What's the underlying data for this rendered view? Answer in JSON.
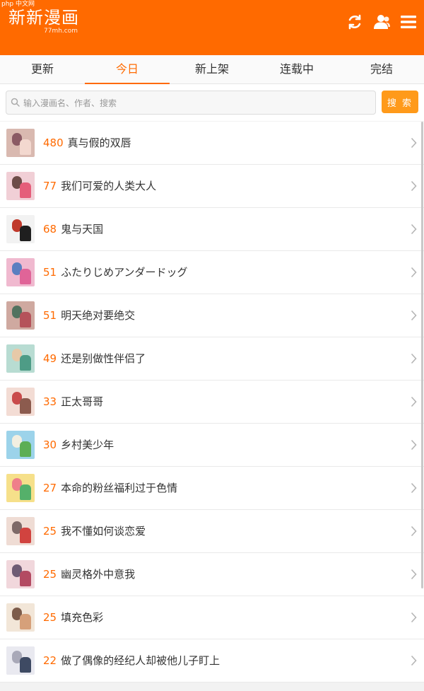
{
  "watermark": "php 中文网",
  "header": {
    "logo_text": "新新漫画",
    "logo_sub": "77mh.com",
    "icons": [
      "refresh-icon",
      "user-icon",
      "menu-icon"
    ],
    "bg_color": "#ff6a00"
  },
  "tabs": [
    {
      "label": "更新",
      "active": false
    },
    {
      "label": "今日",
      "active": true
    },
    {
      "label": "新上架",
      "active": false
    },
    {
      "label": "连载中",
      "active": false
    },
    {
      "label": "完结",
      "active": false
    }
  ],
  "search": {
    "placeholder": "输入漫画名、作者、搜索",
    "value": "",
    "button_label": "搜 索"
  },
  "list": [
    {
      "count": "480",
      "title": "真与假的双唇",
      "palette": [
        "#d9b9b0",
        "#f3d8cf",
        "#8a5a64"
      ]
    },
    {
      "count": "77",
      "title": "我们可爱的人类大人",
      "palette": [
        "#f1cfd6",
        "#e55e7a",
        "#6d4c48"
      ]
    },
    {
      "count": "68",
      "title": "鬼与天国",
      "palette": [
        "#f2f2f2",
        "#1f1f1f",
        "#c0392b"
      ]
    },
    {
      "count": "51",
      "title": "ふたりじめアンダードッグ",
      "palette": [
        "#f0b9cf",
        "#e06498",
        "#5a7fc0"
      ]
    },
    {
      "count": "51",
      "title": "明天绝对要绝交",
      "palette": [
        "#cfa9a0",
        "#b5525a",
        "#52725f"
      ]
    },
    {
      "count": "49",
      "title": "还是别做性伴侣了",
      "palette": [
        "#b8dcd2",
        "#4e9c86",
        "#e7c9a8"
      ]
    },
    {
      "count": "33",
      "title": "正太哥哥",
      "palette": [
        "#f3dcd4",
        "#8c5b4e",
        "#c94b4b"
      ]
    },
    {
      "count": "30",
      "title": "乡村美少年",
      "palette": [
        "#9cd3ea",
        "#5cae55",
        "#f2efe1"
      ]
    },
    {
      "count": "27",
      "title": "本命的粉丝福利过于色情",
      "palette": [
        "#f6e08a",
        "#55b06a",
        "#ef7f8a"
      ]
    },
    {
      "count": "25",
      "title": "我不懂如何谈恋爱",
      "palette": [
        "#efdcd4",
        "#d1433f",
        "#7e6a68"
      ]
    },
    {
      "count": "25",
      "title": "幽灵格外中意我",
      "palette": [
        "#f1d7dc",
        "#b34a62",
        "#6f5b74"
      ]
    },
    {
      "count": "25",
      "title": "填充色彩",
      "palette": [
        "#f2e6d8",
        "#d6a07a",
        "#7d5c4b"
      ]
    },
    {
      "count": "22",
      "title": "做了偶像的经纪人却被他儿子盯上",
      "palette": [
        "#e9e9f0",
        "#3e4a63",
        "#a9a9b8"
      ]
    }
  ]
}
